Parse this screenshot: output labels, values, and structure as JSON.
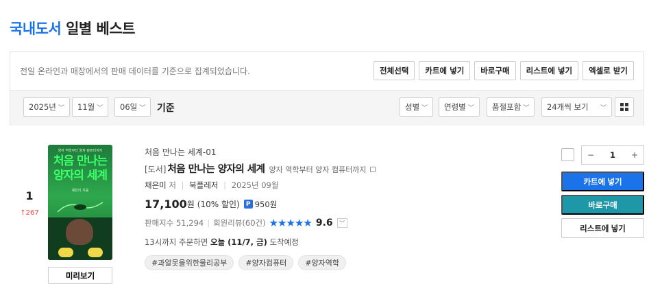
{
  "page": {
    "title_accent": "국내도서",
    "title_rest": "일별 베스트"
  },
  "toolbar": {
    "description": "전일 온라인과 매장에서의 판매 데이터를 기준으로 집계되었습니다.",
    "actions": [
      "전체선택",
      "카트에 넣기",
      "바로구매",
      "리스트에 넣기",
      "엑셀로 받기"
    ]
  },
  "filters": {
    "year": "2025년",
    "month": "11월",
    "day": "06일",
    "basis_label": "기준",
    "gender": "성별",
    "age": "연령별",
    "soldout": "품절포함",
    "per_page": "24개씩 보기"
  },
  "item": {
    "rank": "1",
    "rank_change": "267",
    "cover": {
      "subtitle": "양자 역학부터 양자 컴퓨터까지",
      "title_line1": "처음 만나는",
      "title_line2": "양자의 세계",
      "author": "채은미 지음"
    },
    "preview_label": "미리보기",
    "series": "처음 만나는 세계-01",
    "category": "[도서]",
    "book_title": "처음 만나는 양자의 세계",
    "subtitle": "양자 역학부터 양자 컴퓨터까지",
    "author": "채은미",
    "author_role": "저",
    "publisher": "북플레저",
    "pub_date": "2025년 09월",
    "price": "17,100",
    "price_unit": "원",
    "discount": "(10% 할인)",
    "point_badge": "P",
    "points": "950원",
    "sales_index": "판매지수 51,294",
    "reviews": "회원리뷰(60건)",
    "stars": "★★★★★",
    "score": "9.6",
    "delivery_prefix": "13시까지 주문하면",
    "delivery_date": "오늘 (11/7, 금)",
    "delivery_suffix": "도착예정",
    "tags": [
      "#과알못을위한물리공부",
      "#양자컴퓨터",
      "#양자역학"
    ],
    "quantity": "1",
    "qty_minus": "−",
    "qty_plus": "+",
    "btn_cart": "카트에 넣기",
    "btn_buy": "바로구매",
    "btn_list": "리스트에 넣기"
  },
  "colors": {
    "accent": "#1a73e8",
    "buy": "#1e98a8",
    "rank_up": "#e8453c"
  }
}
